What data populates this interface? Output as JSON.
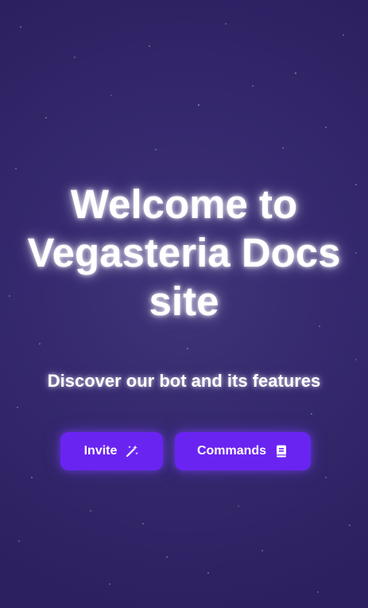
{
  "hero": {
    "title_line1": "Welcome to",
    "title_line2": "Vegasteria Docs",
    "title_line3": "site",
    "subtitle": "Discover our bot and its features"
  },
  "actions": {
    "invite_label": "Invite",
    "invite_icon": "magic-wand-icon",
    "commands_label": "Commands",
    "commands_icon": "book-icon"
  },
  "colors": {
    "background": "#36296e",
    "button": "#6a24f2",
    "text": "#ffffff"
  }
}
